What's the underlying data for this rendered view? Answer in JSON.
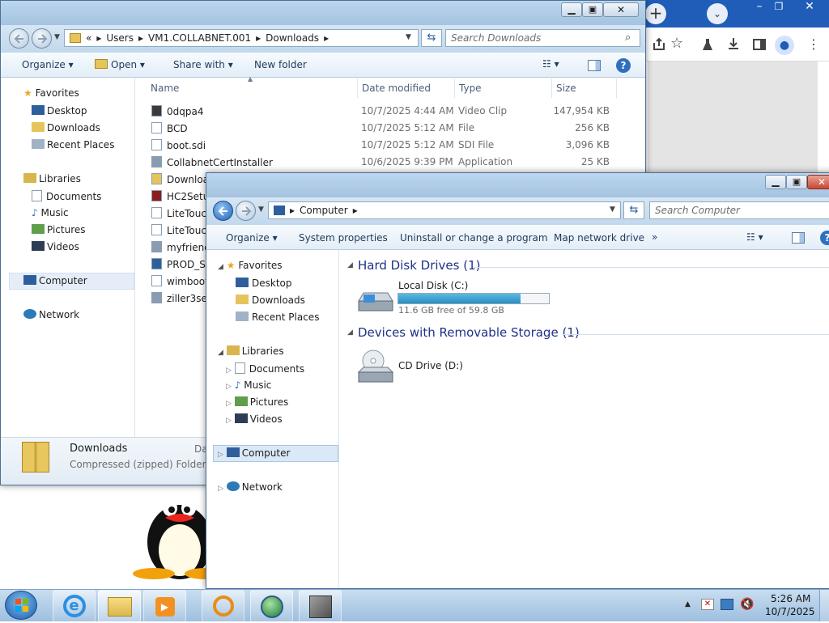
{
  "browser": {
    "icons": [
      "new-tab-plus-icon",
      "tab-list-chevron-icon",
      "share-icon",
      "bookmark-star-icon",
      "extension-flask-icon",
      "download-icon",
      "side-panel-icon",
      "profile-icon",
      "menu-kebab-icon"
    ]
  },
  "downloads_window": {
    "breadcrumb": [
      "«",
      "Users",
      "VM1.COLLABNET.001",
      "Downloads"
    ],
    "search_placeholder": "Search Downloads",
    "toolbar": {
      "organize": "Organize",
      "open": "Open",
      "share_with": "Share with",
      "new_folder": "New folder"
    },
    "columns": {
      "name": "Name",
      "date": "Date modified",
      "type": "Type",
      "size": "Size"
    },
    "files": [
      {
        "name": "0dqpa4",
        "date": "10/7/2025 4:44 AM",
        "type": "Video Clip",
        "size": "147,954 KB",
        "icon": "video-file-icon"
      },
      {
        "name": "BCD",
        "date": "10/7/2025 5:12 AM",
        "type": "File",
        "size": "256 KB",
        "icon": "file-icon"
      },
      {
        "name": "boot.sdi",
        "date": "10/7/2025 5:12 AM",
        "type": "SDI File",
        "size": "3,096 KB",
        "icon": "file-icon"
      },
      {
        "name": "CollabnetCertInstaller",
        "date": "10/6/2025 9:39 PM",
        "type": "Application",
        "size": "25 KB",
        "icon": "application-icon"
      },
      {
        "name": "Downloa",
        "date": "",
        "type": "",
        "size": "",
        "icon": "zip-folder-icon"
      },
      {
        "name": "HC2Setu",
        "date": "",
        "type": "",
        "size": "",
        "icon": "archive-icon"
      },
      {
        "name": "LiteTouc",
        "date": "",
        "type": "",
        "size": "",
        "icon": "file-icon"
      },
      {
        "name": "LiteTouc",
        "date": "",
        "type": "",
        "size": "",
        "icon": "file-icon"
      },
      {
        "name": "myfriend",
        "date": "",
        "type": "",
        "size": "",
        "icon": "application-icon"
      },
      {
        "name": "PROD_St",
        "date": "",
        "type": "",
        "size": "",
        "icon": "window-file-icon"
      },
      {
        "name": "wimboot",
        "date": "",
        "type": "",
        "size": "",
        "icon": "file-icon"
      },
      {
        "name": "ziller3set",
        "date": "",
        "type": "",
        "size": "",
        "icon": "application-icon"
      }
    ],
    "nav": {
      "favorites": "Favorites",
      "desktop": "Desktop",
      "downloads": "Downloads",
      "recent": "Recent Places",
      "libraries": "Libraries",
      "documents": "Documents",
      "music": "Music",
      "pictures": "Pictures",
      "videos": "Videos",
      "computer": "Computer",
      "network": "Network"
    },
    "details": {
      "name": "Downloads",
      "type": "Compressed (zipped) Folder",
      "extra": "Da"
    }
  },
  "computer_window": {
    "breadcrumb": [
      "Computer"
    ],
    "search_placeholder": "Search Computer",
    "toolbar": {
      "organize": "Organize",
      "system_properties": "System properties",
      "uninstall": "Uninstall or change a program",
      "map_drive": "Map network drive",
      "more": "»"
    },
    "nav": {
      "favorites": "Favorites",
      "desktop": "Desktop",
      "downloads": "Downloads",
      "recent": "Recent Places",
      "libraries": "Libraries",
      "documents": "Documents",
      "music": "Music",
      "pictures": "Pictures",
      "videos": "Videos",
      "computer": "Computer",
      "network": "Network"
    },
    "hard_disk_header": "Hard Disk Drives (1)",
    "local_disk": {
      "name": "Local Disk (C:)",
      "free": "11.6 GB free of 59.8 GB",
      "used_fraction": 0.81
    },
    "removable_header": "Devices with Removable Storage (1)",
    "cd_drive": "CD Drive (D:)"
  },
  "taskbar": {
    "time": "5:26 AM",
    "date": "10/7/2025",
    "show_hidden": "▲"
  },
  "colors": {
    "taskbar": "#a9c8e6",
    "section": "#1e3287",
    "disk_bar": "#2a8fc0"
  }
}
